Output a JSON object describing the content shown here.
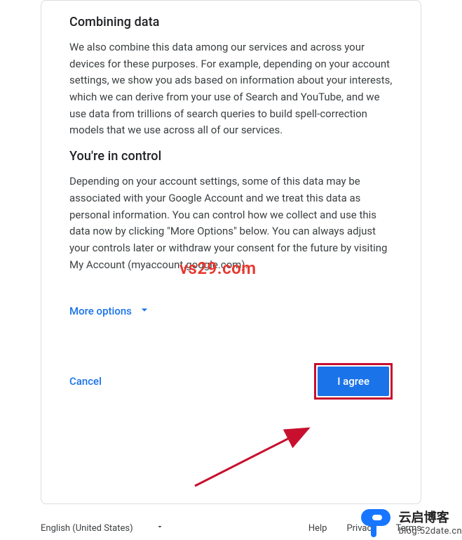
{
  "sections": {
    "combining": {
      "heading": "Combining data",
      "body": "We also combine this data among our services and across your devices for these purposes. For example, depending on your account settings, we show you ads based on information about your interests, which we can derive from your use of Search and YouTube, and we use data from trillions of search queries to build spell-correction models that we use across all of our services."
    },
    "control": {
      "heading": "You're in control",
      "body": "Depending on your account settings, some of this data may be associated with your Google Account and we treat this data as personal information. You can control how we collect and use this data now by clicking \"More Options\" below. You can always adjust your controls later or withdraw your consent for the future by visiting My Account (myaccount.google.com)."
    }
  },
  "moreOptions": "More options",
  "actions": {
    "cancel": "Cancel",
    "agree": "I agree"
  },
  "footer": {
    "language": "English (United States)",
    "links": {
      "help": "Help",
      "privacy": "Privacy",
      "terms": "Terms"
    }
  },
  "watermarks": {
    "w1": "vs29.com",
    "w2cn": "云启博客",
    "w2url": "blog.52date.cn"
  }
}
